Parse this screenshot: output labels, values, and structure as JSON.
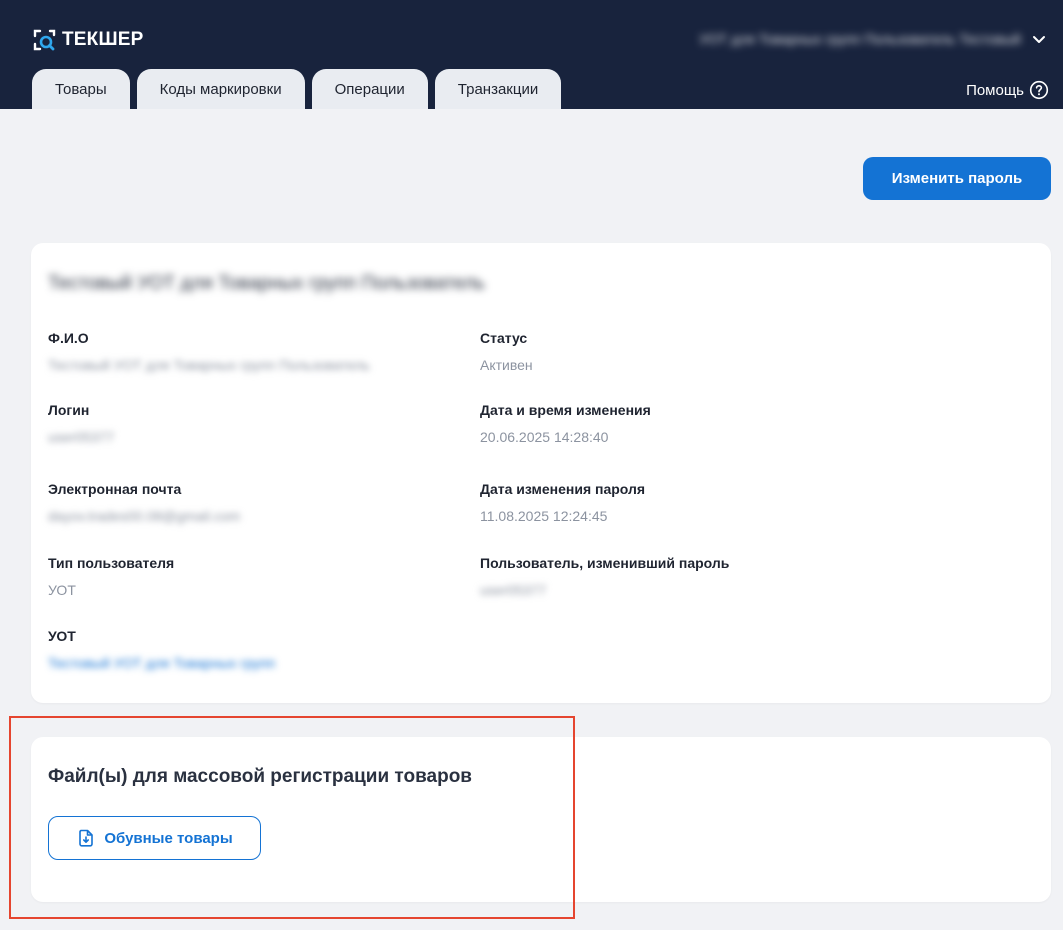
{
  "header": {
    "logo_text": "ТЕКШЕР",
    "user_name": "УОТ для Товарных групп Пользователь Тестовый",
    "help_label": "Помощь",
    "tabs": [
      {
        "label": "Товары"
      },
      {
        "label": "Коды маркировки"
      },
      {
        "label": "Операции"
      },
      {
        "label": "Транзакции"
      }
    ]
  },
  "actions": {
    "change_password_label": "Изменить пароль"
  },
  "profile": {
    "heading": "Тестовый УОТ для Товарных групп Пользователь",
    "fields": {
      "fio": {
        "label": "Ф.И.О",
        "value": "Тестовый УОТ для Товарных групп Пользователь"
      },
      "status": {
        "label": "Статус",
        "value": "Активен"
      },
      "login": {
        "label": "Логин",
        "value": "user05377"
      },
      "changed_at": {
        "label": "Дата и время изменения",
        "value": "20.06.2025 14:28:40"
      },
      "email": {
        "label": "Электронная почта",
        "value": "dayov.trades00.08@gmail.com"
      },
      "password_changed_at": {
        "label": "Дата изменения пароля",
        "value": "11.08.2025 12:24:45"
      },
      "user_type": {
        "label": "Тип пользователя",
        "value": "УОТ"
      },
      "password_changed_by": {
        "label": "Пользователь, изменивший пароль",
        "value": "user05377"
      },
      "uot": {
        "label": "УОТ",
        "value": "Тестовый УОТ для Товарных групп"
      }
    }
  },
  "files": {
    "title": "Файл(ы) для массовой регистрации товаров",
    "download_label": "Обувные товары"
  },
  "colors": {
    "header_bg": "#18233d",
    "accent": "#1473d4",
    "highlight": "#e5452f"
  }
}
